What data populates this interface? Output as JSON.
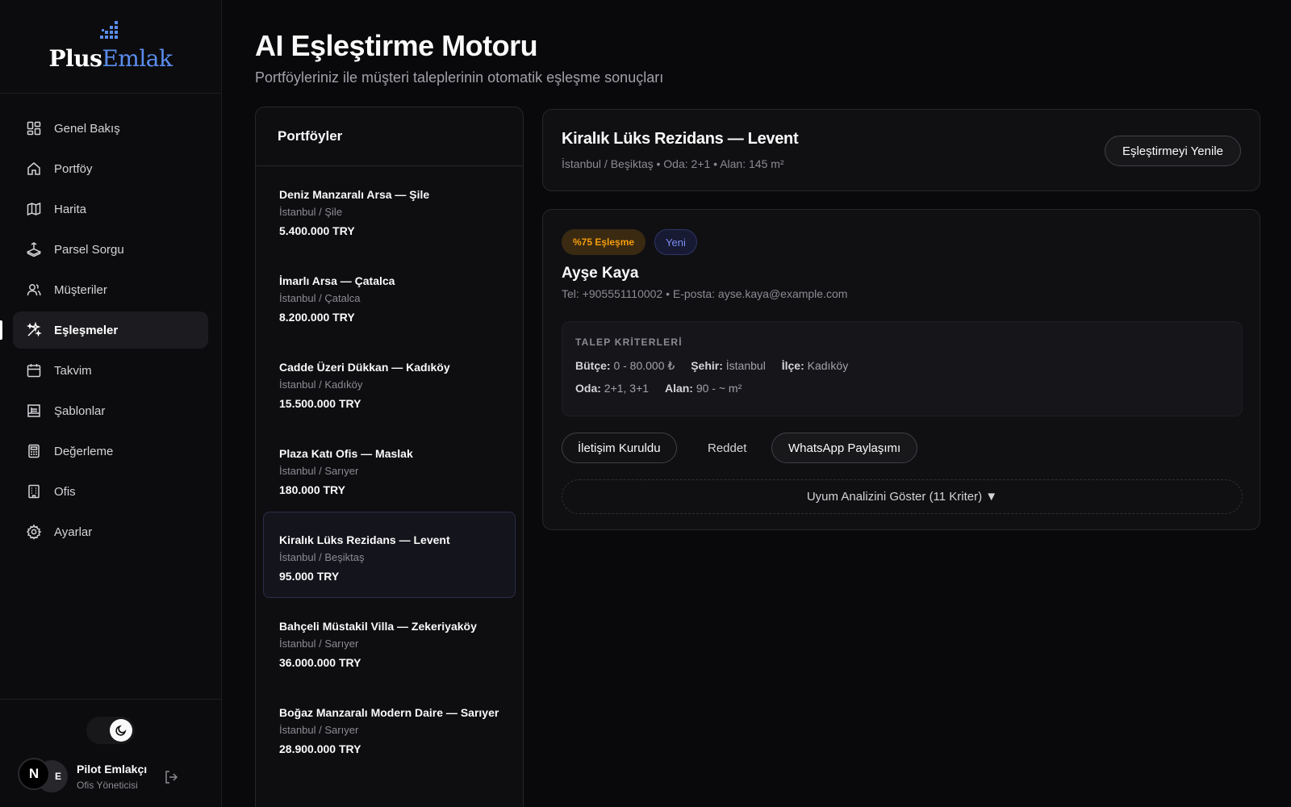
{
  "brand": {
    "part1": "Plus",
    "part2": "Emlak"
  },
  "sidebar": {
    "items": [
      {
        "label": "Genel Bakış",
        "icon": "dashboard-icon"
      },
      {
        "label": "Portföy",
        "icon": "home-icon"
      },
      {
        "label": "Harita",
        "icon": "map-icon"
      },
      {
        "label": "Parsel Sorgu",
        "icon": "land-parcel-icon"
      },
      {
        "label": "Müşteriler",
        "icon": "users-icon"
      },
      {
        "label": "Eşleşmeler",
        "icon": "sparkles-icon",
        "active": true
      },
      {
        "label": "Takvim",
        "icon": "calendar-icon"
      },
      {
        "label": "Şablonlar",
        "icon": "template-icon"
      },
      {
        "label": "Değerleme",
        "icon": "calculator-icon"
      },
      {
        "label": "Ofis",
        "icon": "building-icon"
      },
      {
        "label": "Ayarlar",
        "icon": "gear-icon"
      }
    ]
  },
  "user": {
    "initial": "N",
    "initials_back": "E",
    "name": "Pilot Emlakçı",
    "role": "Ofis Yöneticisi"
  },
  "page": {
    "title": "AI Eşleştirme Motoru",
    "subtitle": "Portföyleriniz ile müşteri taleplerinin otomatik eşleşme sonuçları"
  },
  "portfolios": {
    "heading": "Portföyler",
    "items": [
      {
        "title": "Deniz Manzaralı Arsa — Şile",
        "location": "İstanbul / Şile",
        "price": "5.400.000 TRY"
      },
      {
        "title": "İmarlı Arsa — Çatalca",
        "location": "İstanbul / Çatalca",
        "price": "8.200.000 TRY"
      },
      {
        "title": "Cadde Üzeri Dükkan — Kadıköy",
        "location": "İstanbul / Kadıköy",
        "price": "15.500.000 TRY"
      },
      {
        "title": "Plaza Katı Ofis — Maslak",
        "location": "İstanbul / Sarıyer",
        "price": "180.000 TRY"
      },
      {
        "title": "Kiralık Lüks Rezidans — Levent",
        "location": "İstanbul / Beşiktaş",
        "price": "95.000 TRY",
        "selected": true
      },
      {
        "title": "Bahçeli Müstakil Villa — Zekeriyaköy",
        "location": "İstanbul / Sarıyer",
        "price": "36.000.000 TRY"
      },
      {
        "title": "Boğaz Manzaralı Modern Daire — Sarıyer",
        "location": "İstanbul / Sarıyer",
        "price": "28.900.000 TRY"
      }
    ]
  },
  "selected_property": {
    "title": "Kiralık Lüks Rezidans — Levent",
    "meta": "İstanbul / Beşiktaş • Oda: 2+1 • Alan: 145 m²",
    "refresh_label": "Eşleştirmeyi Yenile"
  },
  "match": {
    "score_badge": "%75 Eşleşme",
    "status_badge": "Yeni",
    "client_name": "Ayşe Kaya",
    "contact": "Tel: +905551110002 • E-posta: ayse.kaya@example.com",
    "criteria": {
      "title": "TALEP KRİTERLERİ",
      "budget_label": "Bütçe:",
      "budget": "0 - 80.000 ₺",
      "city_label": "Şehir:",
      "city": "İstanbul",
      "district_label": "İlçe:",
      "district": "Kadıköy",
      "rooms_label": "Oda:",
      "rooms": "2+1, 3+1",
      "area_label": "Alan:",
      "area": "90 - ~ m²"
    },
    "actions": {
      "contact": "İletişim Kuruldu",
      "reject": "Reddet",
      "whatsapp": "WhatsApp Paylaşımı",
      "analysis": "Uyum Analizini Göster (11 Kriter) ▼"
    }
  },
  "colors": {
    "accent": "#5b8def",
    "score": "#f59e0b",
    "new_badge": "#7b8cf0",
    "background": "#09090b"
  }
}
